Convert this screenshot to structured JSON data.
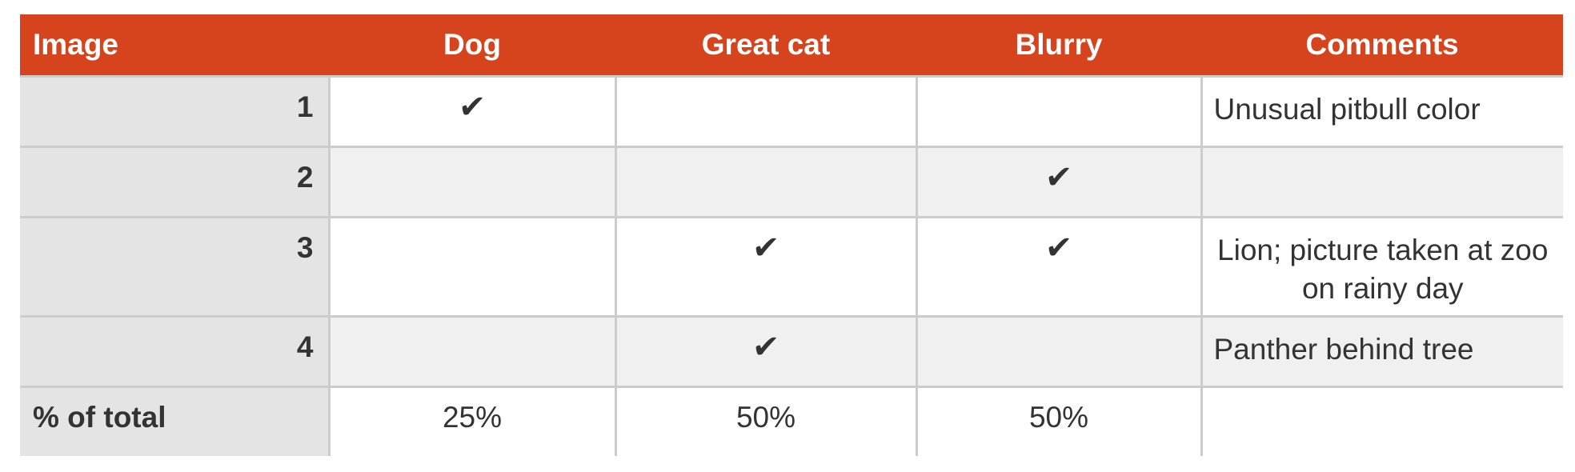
{
  "colors": {
    "header_bg": "#D5441C",
    "header_text": "#FFFFFF",
    "label_col_bg": "#E4E4E4",
    "shaded_row_bg": "#F0F0F0",
    "grid_line": "#CCCCCC",
    "text": "#333333"
  },
  "headers": {
    "image": "Image",
    "dog": "Dog",
    "great_cat": "Great cat",
    "blurry": "Blurry",
    "comments": "Comments"
  },
  "check_glyph": "✔",
  "rows": [
    {
      "label": "1",
      "dog": "✔",
      "great_cat": "",
      "blurry": "",
      "comment": "Unusual pitbull color"
    },
    {
      "label": "2",
      "dog": "",
      "great_cat": "",
      "blurry": "✔",
      "comment": ""
    },
    {
      "label": "3",
      "dog": "",
      "great_cat": "✔",
      "blurry": "✔",
      "comment": "Lion; picture taken at zoo on rainy day"
    },
    {
      "label": "4",
      "dog": "",
      "great_cat": "✔",
      "blurry": "",
      "comment": "Panther behind tree"
    }
  ],
  "total": {
    "label": "% of total",
    "dog": "25%",
    "great_cat": "50%",
    "blurry": "50%",
    "comment": ""
  }
}
